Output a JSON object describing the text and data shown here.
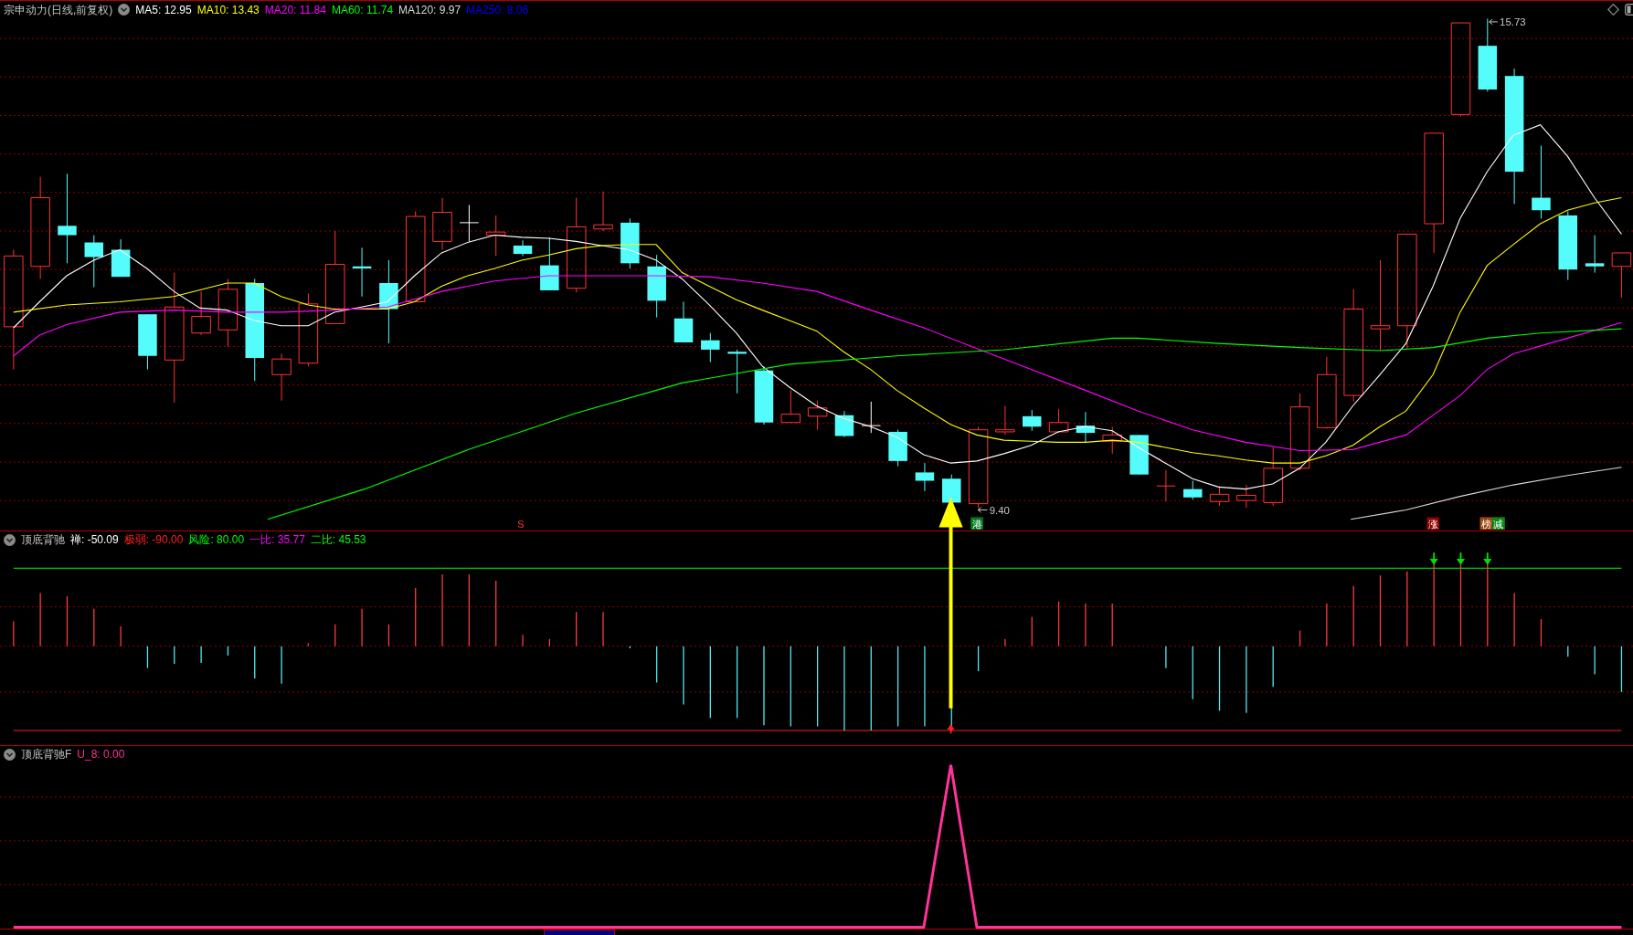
{
  "main_panel": {
    "title": "宗申动力(日线,前复权)",
    "legend": [
      {
        "label": "MA5: 12.95",
        "color": "#ffffff"
      },
      {
        "label": "MA10: 13.43",
        "color": "#ffff00"
      },
      {
        "label": "MA20: 11.84",
        "color": "#ff00ff"
      },
      {
        "label": "MA60: 11.74",
        "color": "#00ff00"
      },
      {
        "label": "MA120: 9.97",
        "color": "#d8d8d8"
      },
      {
        "label": "MA250: 8.06",
        "color": "#0000ff"
      }
    ],
    "high_label": "15.73",
    "low_label": "9.40",
    "signals": [
      {
        "kind": "letter",
        "text": "S",
        "color": "#ff3030"
      },
      {
        "kind": "tag",
        "text": "港",
        "color": "#007a1f"
      },
      {
        "kind": "tag",
        "text": "涨",
        "color": "#8b0000"
      },
      {
        "kind": "tag",
        "text": "榜",
        "color": "#9a4a10"
      },
      {
        "kind": "tag",
        "text": "减",
        "color": "#0a8a1a"
      }
    ]
  },
  "indicator_panel": {
    "title": "顶底背驰",
    "legend": [
      {
        "label": "禅: -50.09",
        "color": "#ffffff"
      },
      {
        "label": "极弱: -90.00",
        "color": "#ff2020"
      },
      {
        "label": "风险: 80.00",
        "color": "#00ff00"
      },
      {
        "label": "一比: 35.77",
        "color": "#ff00ff"
      },
      {
        "label": "二比: 45.53",
        "color": "#00ff00"
      }
    ]
  },
  "signal_panel": {
    "title": "顶底背驰F",
    "legend": [
      {
        "label": "U_8: 0.00",
        "color": "#ff3399"
      }
    ]
  }
}
